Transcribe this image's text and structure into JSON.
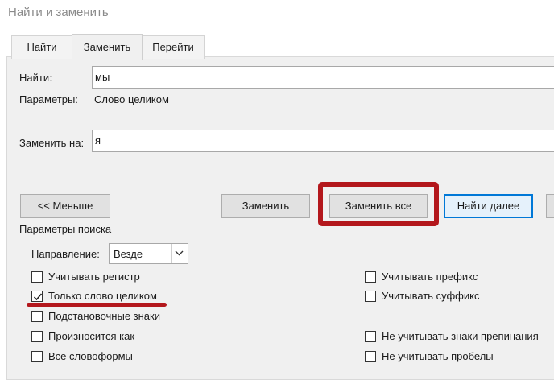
{
  "window": {
    "title": "Найти и заменить"
  },
  "tabs": [
    {
      "label": "Найти"
    },
    {
      "label": "Заменить"
    },
    {
      "label": "Перейти"
    }
  ],
  "find": {
    "label": "Найти:",
    "value": "мы"
  },
  "options": {
    "label": "Параметры:",
    "value": "Слово целиком"
  },
  "replace": {
    "label": "Заменить на:",
    "value": "я"
  },
  "buttons": {
    "less": "<< Меньше",
    "replace": "Заменить",
    "replace_all": "Заменить все",
    "find_next": "Найти далее"
  },
  "search_options": {
    "title": "Параметры поиска",
    "direction_label": "Направление:",
    "direction_value": "Везде",
    "left": [
      {
        "label": "Учитывать регистр",
        "checked": false
      },
      {
        "label": "Только слово целиком",
        "checked": true
      },
      {
        "label": "Подстановочные знаки",
        "checked": false
      },
      {
        "label": "Произносится как",
        "checked": false
      },
      {
        "label": "Все словоформы",
        "checked": false
      }
    ],
    "right": [
      {
        "label": "Учитывать префикс",
        "checked": false
      },
      {
        "label": "Учитывать суффикс",
        "checked": false
      },
      {
        "label": "Не учитывать знаки препинания",
        "checked": false
      },
      {
        "label": "Не учитывать пробелы",
        "checked": false
      }
    ]
  },
  "colors": {
    "highlight": "#b3171c",
    "default_button_border": "#0078d7",
    "panel": "#f0f0f0"
  }
}
